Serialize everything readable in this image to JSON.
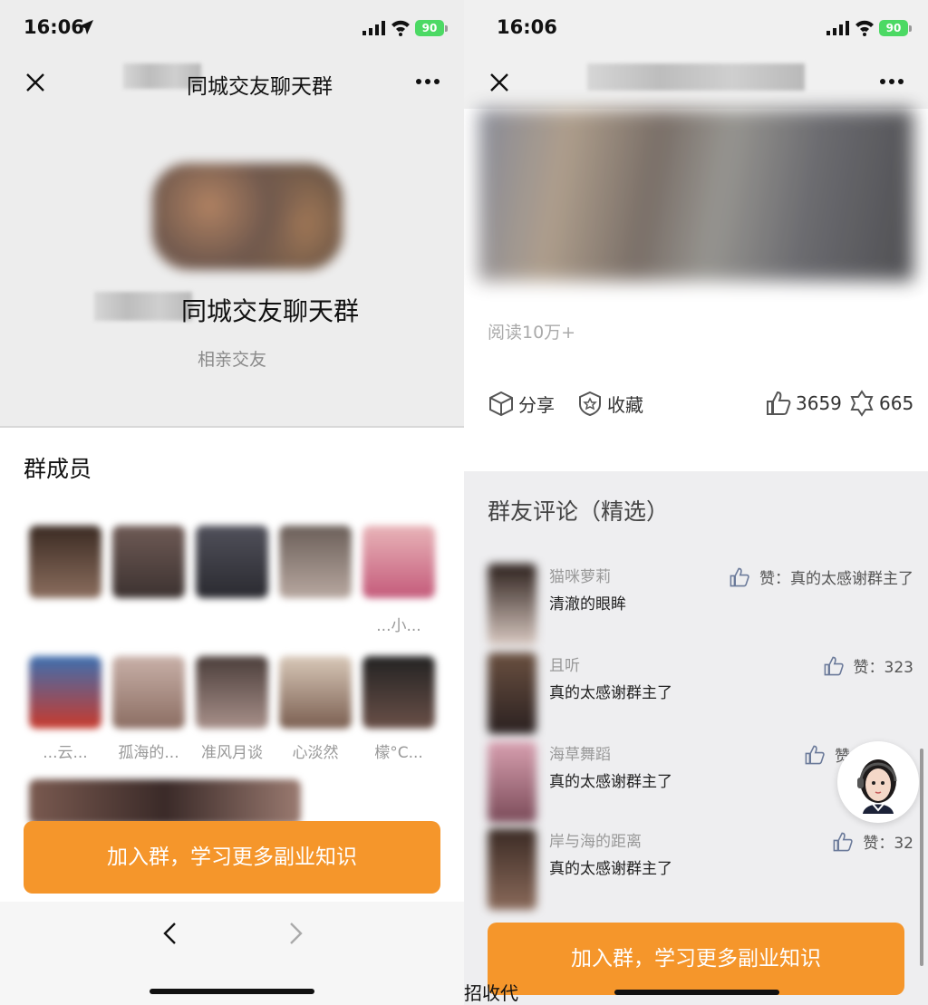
{
  "left": {
    "status": {
      "time": "16:06",
      "battery": "90"
    },
    "nav": {
      "title_visible": "同城交友聊天群",
      "close_icon": "close-icon",
      "more_icon": "more-icon"
    },
    "group": {
      "name_visible": "同城交友聊天群",
      "tag": "相亲交友"
    },
    "members": {
      "title": "群成员",
      "row1_names": [
        "",
        "",
        "",
        "",
        "...小..."
      ],
      "row2_names": [
        "...云...",
        "孤海的...",
        "准风月谈",
        "心淡然",
        "檬°C..."
      ]
    },
    "join_button": "加入群，学习更多副业知识",
    "browser_nav": {
      "back_icon": "chevron-left-icon",
      "forward_icon": "chevron-right-icon"
    }
  },
  "right": {
    "status": {
      "time": "16:06",
      "battery": "90"
    },
    "article": {
      "read_count": "阅读10万+"
    },
    "actions": {
      "share": "分享",
      "favorite": "收藏",
      "likes": "3659",
      "wows": "665"
    },
    "comments": {
      "title": "群友评论（精选）",
      "items": [
        {
          "name": "猫咪萝莉",
          "text": "清澈的眼眸",
          "like": "赞：真的太感谢群主了"
        },
        {
          "name": "且听",
          "text": "真的太感谢群主了",
          "like": "赞：323"
        },
        {
          "name": "海草舞蹈",
          "text": "真的太感谢群主了",
          "like": "赞"
        },
        {
          "name": "岸与海的距离",
          "text": "真的太感谢群主了",
          "like": "赞：32"
        }
      ]
    },
    "join_button": "加入群，学习更多副业知识",
    "bottom_cut_text": "招收代"
  },
  "colors": {
    "accent": "#f5962b",
    "battery": "#4cd964"
  }
}
